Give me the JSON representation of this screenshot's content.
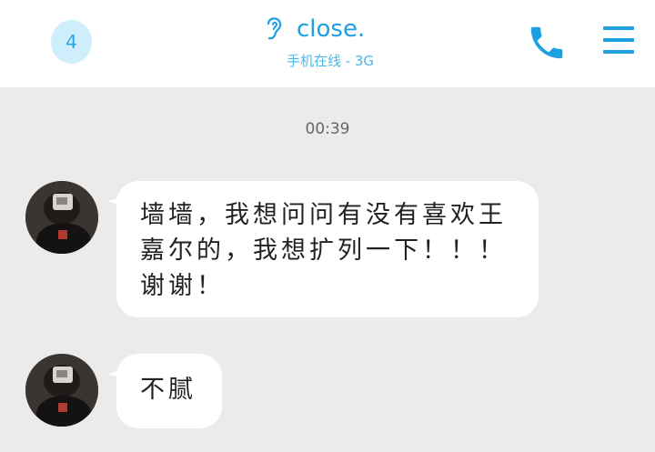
{
  "header": {
    "badge_count": "4",
    "contact_name": "close.",
    "status": "手机在线 - 3G",
    "icons": {
      "contact": "ear-icon",
      "call": "phone-icon",
      "menu": "menu-icon"
    }
  },
  "chat": {
    "timestamp": "00:39",
    "messages": [
      {
        "sender": "other",
        "text": "墙墙，我想问问有没有喜欢王嘉尔的，我想扩列一下！！！谢谢！"
      },
      {
        "sender": "other",
        "text": "不腻"
      }
    ]
  },
  "colors": {
    "accent": "#1ba0e2",
    "badge_bg": "#cfeefc",
    "chat_bg": "#ebebeb",
    "bubble_bg": "#ffffff"
  }
}
